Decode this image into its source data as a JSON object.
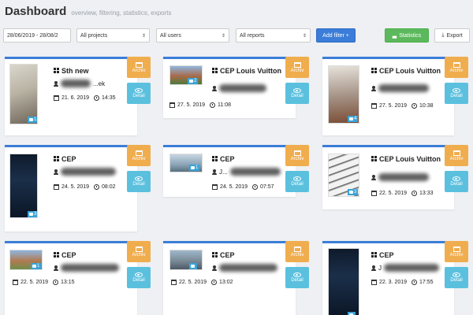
{
  "header": {
    "title": "Dashboard",
    "subtitle": "overview, filtering, statistics, exports"
  },
  "toolbar": {
    "date_range": "28/06/2019 - 28/08/2",
    "projects_select": "All projects",
    "users_select": "All users",
    "reports_select": "All reports",
    "add_filter_label": "Add filter +",
    "statistics_label": "Statistics",
    "export_label": "Export"
  },
  "actions": {
    "archiv": "Archiv",
    "detail": "Detail"
  },
  "colors": {
    "accent": "#3b7dd8",
    "archiv": "#f0ad4e",
    "detail": "#5bc0de",
    "statistics": "#5cb85c"
  },
  "cards": [
    {
      "title": "Sth new",
      "user": "...ek",
      "date": "21. 6. 2019",
      "time": "14:35",
      "photo_count": "1"
    },
    {
      "title": "CEP Louis Vuitton",
      "user": "",
      "date": "27. 5. 2019",
      "time": "11:08",
      "photo_count": "2"
    },
    {
      "title": "CEP Louis Vuitton",
      "user": "",
      "date": "27. 5. 2019",
      "time": "10:38",
      "photo_count": "4"
    },
    {
      "title": "CEP",
      "user": "",
      "date": "24. 5. 2019",
      "time": "08:02",
      "photo_count": "3"
    },
    {
      "title": "CEP",
      "user": "J...",
      "date": "24. 5. 2019",
      "time": "07:57",
      "photo_count": "1"
    },
    {
      "title": "CEP Louis Vuitton",
      "user": "",
      "date": "22. 5. 2019",
      "time": "13:33",
      "photo_count": "3"
    },
    {
      "title": "CEP",
      "user": "",
      "date": "22. 5. 2019",
      "time": "13:15",
      "photo_count": "1"
    },
    {
      "title": "CEP",
      "user": "",
      "date": "22. 5. 2019",
      "time": "13:02",
      "photo_count": ""
    },
    {
      "title": "CEP",
      "user": "J",
      "date": "22. 3. 2019",
      "time": "17:55",
      "photo_count": ""
    }
  ]
}
